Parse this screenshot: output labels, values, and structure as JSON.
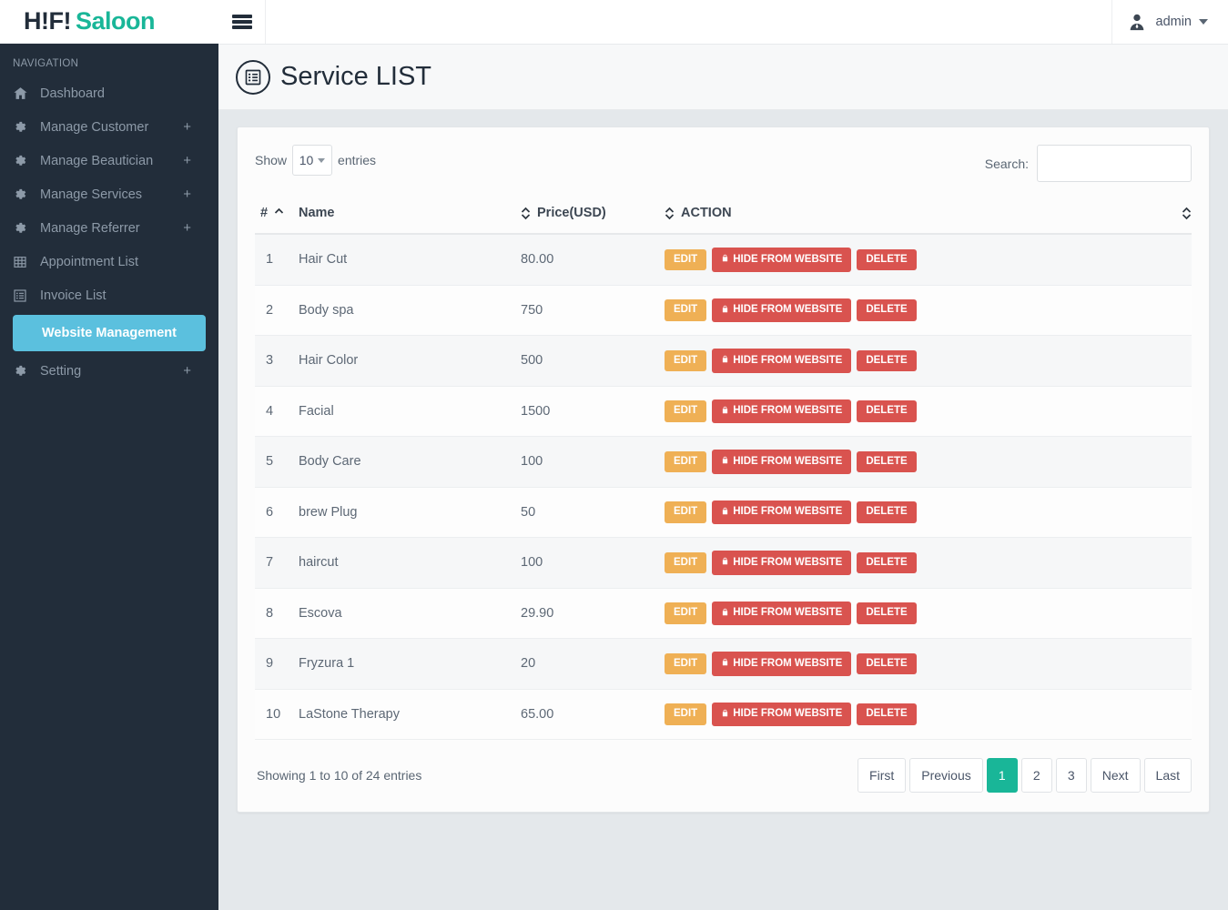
{
  "brand": {
    "dark": "H!F!",
    "teal": "Saloon"
  },
  "sidebar": {
    "nav_title": "NAVIGATION",
    "items": [
      {
        "label": "Dashboard",
        "icon": "home-icon",
        "expandable": false
      },
      {
        "label": "Manage Customer",
        "icon": "gear-icon",
        "expandable": true,
        "plus": "+"
      },
      {
        "label": "Manage Beautician",
        "icon": "gear-icon",
        "expandable": true,
        "plus": "+"
      },
      {
        "label": "Manage Services",
        "icon": "gear-icon",
        "expandable": true,
        "plus": "+"
      },
      {
        "label": "Manage Referrer",
        "icon": "gear-icon",
        "expandable": true,
        "plus": "+"
      },
      {
        "label": "Appointment List",
        "icon": "table-icon",
        "expandable": false
      },
      {
        "label": "Invoice List",
        "icon": "list-alt-icon",
        "expandable": false
      },
      {
        "label": "Website Management",
        "icon": "none",
        "expandable": false,
        "active": true
      },
      {
        "label": "Setting",
        "icon": "gear-icon",
        "expandable": true,
        "plus": "+"
      }
    ]
  },
  "topbar": {
    "menu_toggle": "hamburger-icon",
    "user": "admin"
  },
  "page": {
    "title": "Service LIST",
    "title_icon": "list-alt-circle-icon"
  },
  "table_controls": {
    "show_label": "Show",
    "entries_label": "entries",
    "page_length": "10",
    "search_label": "Search:",
    "search_value": "",
    "search_placeholder": ""
  },
  "table": {
    "columns": [
      {
        "key": "num",
        "label": "#",
        "sort": "asc"
      },
      {
        "key": "name",
        "label": "Name",
        "sort": "both"
      },
      {
        "key": "price",
        "label": "Price(USD)",
        "sort": "both"
      },
      {
        "key": "action",
        "label": "ACTION",
        "sort": "both"
      }
    ],
    "buttons": {
      "edit": "EDIT",
      "hide": "HIDE FROM WEBSITE",
      "hide_icon": "lock-icon",
      "delete": "DELETE"
    },
    "rows": [
      {
        "num": "1",
        "name": "Hair Cut",
        "price": "80.00"
      },
      {
        "num": "2",
        "name": "Body spa",
        "price": "750"
      },
      {
        "num": "3",
        "name": "Hair Color",
        "price": "500"
      },
      {
        "num": "4",
        "name": "Facial",
        "price": "1500"
      },
      {
        "num": "5",
        "name": "Body Care",
        "price": "100"
      },
      {
        "num": "6",
        "name": "brew Plug",
        "price": "50"
      },
      {
        "num": "7",
        "name": "haircut",
        "price": "100"
      },
      {
        "num": "8",
        "name": "Escova",
        "price": "29.90"
      },
      {
        "num": "9",
        "name": "Fryzura 1",
        "price": "20"
      },
      {
        "num": "10",
        "name": "LaStone Therapy",
        "price": "65.00"
      }
    ]
  },
  "footer": {
    "info": "Showing 1 to 10 of 24 entries",
    "pagination": [
      {
        "label": "First",
        "active": false
      },
      {
        "label": "Previous",
        "active": false
      },
      {
        "label": "1",
        "active": true,
        "num": true
      },
      {
        "label": "2",
        "active": false,
        "num": true
      },
      {
        "label": "3",
        "active": false,
        "num": true
      },
      {
        "label": "Next",
        "active": false
      },
      {
        "label": "Last",
        "active": false
      }
    ]
  },
  "colors": {
    "sidebar_bg": "#222d3a",
    "brand_teal": "#19b698",
    "active_nav": "#5bc0de",
    "edit_btn": "#efb055",
    "danger_btn": "#d9534f",
    "pagination_active": "#19b698",
    "page_bg": "#e4e8eb"
  }
}
